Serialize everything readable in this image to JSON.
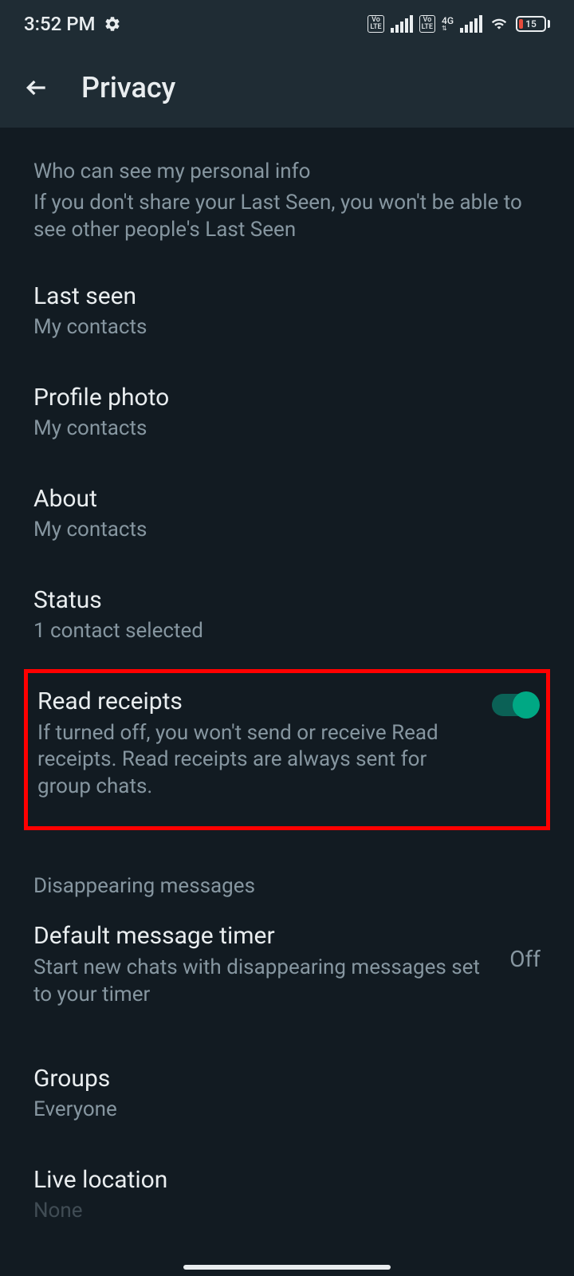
{
  "statusBar": {
    "time": "3:52 PM",
    "network1Label": "Vo LTE",
    "network2Label": "Vo LTE",
    "networkType": "4G",
    "batteryLevel": "15"
  },
  "header": {
    "title": "Privacy"
  },
  "section1": {
    "header": "Who can see my personal info",
    "description": "If you don't share your Last Seen, you won't be able to see other people's Last Seen"
  },
  "lastSeen": {
    "title": "Last seen",
    "value": "My contacts"
  },
  "profilePhoto": {
    "title": "Profile photo",
    "value": "My contacts"
  },
  "about": {
    "title": "About",
    "value": "My contacts"
  },
  "status": {
    "title": "Status",
    "value": "1 contact selected"
  },
  "readReceipts": {
    "title": "Read receipts",
    "description": "If turned off, you won't send or receive Read receipts. Read receipts are always sent for group chats.",
    "enabled": true
  },
  "section2": {
    "header": "Disappearing messages"
  },
  "defaultTimer": {
    "title": "Default message timer",
    "description": "Start new chats with disappearing messages set to your timer",
    "value": "Off"
  },
  "groups": {
    "title": "Groups",
    "value": "Everyone"
  },
  "liveLocation": {
    "title": "Live location",
    "value": "None"
  }
}
